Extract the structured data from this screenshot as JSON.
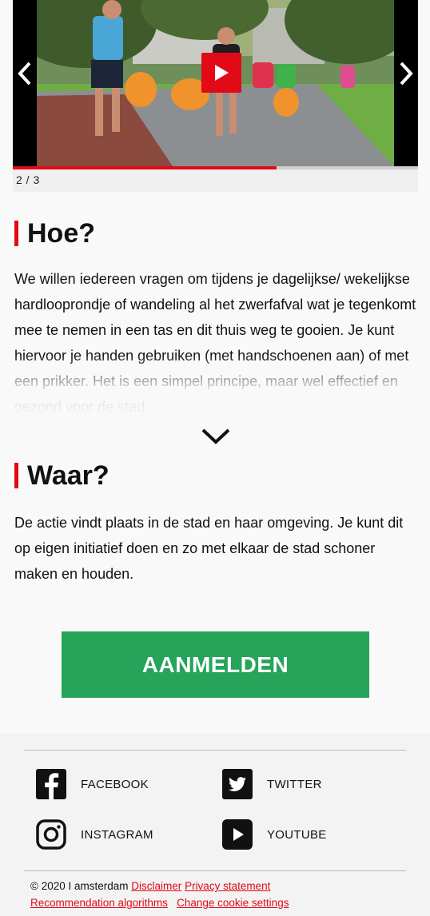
{
  "carousel": {
    "counter": "2 / 3",
    "progress": 0.65,
    "prev_icon": "chevron-left-icon",
    "next_icon": "chevron-right-icon",
    "play_icon": "play-icon"
  },
  "sections": [
    {
      "title": "Hoe?",
      "text": "We willen iedereen vragen om tijdens je dagelijkse/ wekelijkse hardlooprondje of wandeling al het zwerfafval wat je tegenkomt mee te nemen in een tas en dit thuis weg te gooien. Je kunt hiervoor je handen gebruiken (met handschoenen aan) of met een prikker. Het is een simpel principe, maar wel effectief en gezond voor de stad."
    },
    {
      "title": "Waar?",
      "text": "De actie vindt plaats in de stad en haar omgeving. Je kunt dit op eigen initiatief doen en zo met elkaar de stad schoner maken en houden."
    }
  ],
  "cta": {
    "label": "AANMELDEN"
  },
  "footer": {
    "social": [
      {
        "label": "FACEBOOK",
        "icon": "facebook-icon"
      },
      {
        "label": "TWITTER",
        "icon": "twitter-icon"
      },
      {
        "label": "INSTAGRAM",
        "icon": "instagram-icon"
      },
      {
        "label": "YOUTUBE",
        "icon": "youtube-icon"
      }
    ],
    "copyright": "© 2020 I amsterdam",
    "links": {
      "disclaimer": "Disclaimer",
      "privacy": "Privacy statement",
      "recommendation": "Recommendation algorithms",
      "cookies": "Change cookie settings"
    }
  },
  "colors": {
    "accent": "#e10a16",
    "cta": "#26a45a"
  }
}
